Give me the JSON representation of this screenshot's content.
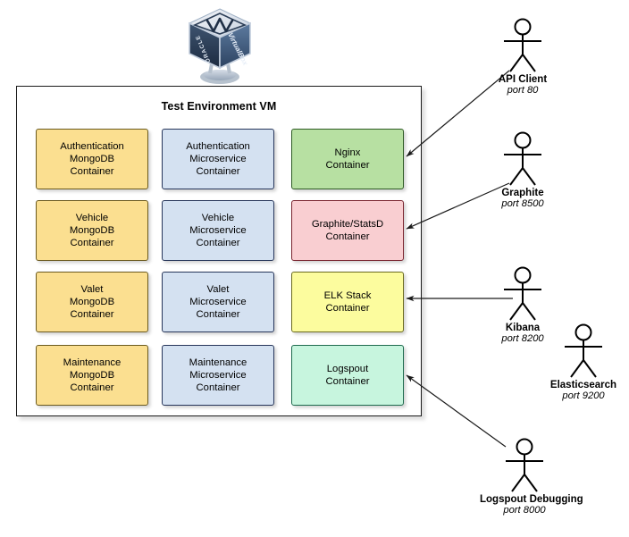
{
  "diagram": {
    "vm": {
      "title": "Test Environment VM",
      "logo_icon": "virtualbox-logo",
      "logo_brand_top": "ORACLE",
      "logo_brand_side": "VirtualBox"
    },
    "columns": [
      {
        "key": "mongodb",
        "color": "#fbdf90",
        "border": "#6b5a1f"
      },
      {
        "key": "microservice",
        "color": "#d4e1f1",
        "border": "#27365a"
      },
      {
        "key": "services",
        "color": "varied",
        "border": "varied"
      }
    ],
    "containers": [
      {
        "id": "auth-mongodb",
        "lines": [
          "Authentication",
          "MongoDB",
          "Container"
        ],
        "color": "#fbdf90",
        "column": 1,
        "row": 1
      },
      {
        "id": "vehicle-mongodb",
        "lines": [
          "Vehicle",
          "MongoDB",
          "Container"
        ],
        "color": "#fbdf90",
        "column": 1,
        "row": 2
      },
      {
        "id": "valet-mongodb",
        "lines": [
          "Valet",
          "MongoDB",
          "Container"
        ],
        "color": "#fbdf90",
        "column": 1,
        "row": 3
      },
      {
        "id": "maintenance-mongodb",
        "lines": [
          "Maintenance",
          "MongoDB",
          "Container"
        ],
        "color": "#fbdf90",
        "column": 1,
        "row": 4
      },
      {
        "id": "auth-microservice",
        "lines": [
          "Authentication",
          "Microservice",
          "Container"
        ],
        "color": "#d4e1f1",
        "column": 2,
        "row": 1
      },
      {
        "id": "vehicle-microservice",
        "lines": [
          "Vehicle",
          "Microservice",
          "Container"
        ],
        "color": "#d4e1f1",
        "column": 2,
        "row": 2
      },
      {
        "id": "valet-microservice",
        "lines": [
          "Valet",
          "Microservice",
          "Container"
        ],
        "color": "#d4e1f1",
        "column": 2,
        "row": 3
      },
      {
        "id": "maintenance-microservice",
        "lines": [
          "Maintenance",
          "Microservice",
          "Container"
        ],
        "color": "#d4e1f1",
        "column": 2,
        "row": 4
      },
      {
        "id": "nginx",
        "lines": [
          "Nginx",
          "Container"
        ],
        "color": "#b7e0a2",
        "column": 3,
        "row": 1
      },
      {
        "id": "graphite-statsd",
        "lines": [
          "Graphite/StatsD",
          "Container"
        ],
        "color": "#f9ced1",
        "column": 3,
        "row": 2
      },
      {
        "id": "elk-stack",
        "lines": [
          "ELK Stack",
          "Container"
        ],
        "color": "#fcfc9e",
        "column": 3,
        "row": 3
      },
      {
        "id": "logspout",
        "lines": [
          "Logspout",
          "Container"
        ],
        "color": "#c7f5de",
        "column": 3,
        "row": 4
      }
    ],
    "actors": [
      {
        "id": "api-client",
        "label": "API Client",
        "port": "port 80",
        "connects_to": "nginx"
      },
      {
        "id": "graphite",
        "label": "Graphite",
        "port": "port 8500",
        "connects_to": "graphite-statsd"
      },
      {
        "id": "kibana",
        "label": "Kibana",
        "port": "port 8200",
        "connects_to": "elk-stack"
      },
      {
        "id": "elasticsearch",
        "label": "Elasticsearch",
        "port": "port 9200",
        "connects_to": ""
      },
      {
        "id": "logspout-debugging",
        "label": "Logspout Debugging",
        "port": "port 8000",
        "connects_to": "logspout"
      }
    ]
  }
}
